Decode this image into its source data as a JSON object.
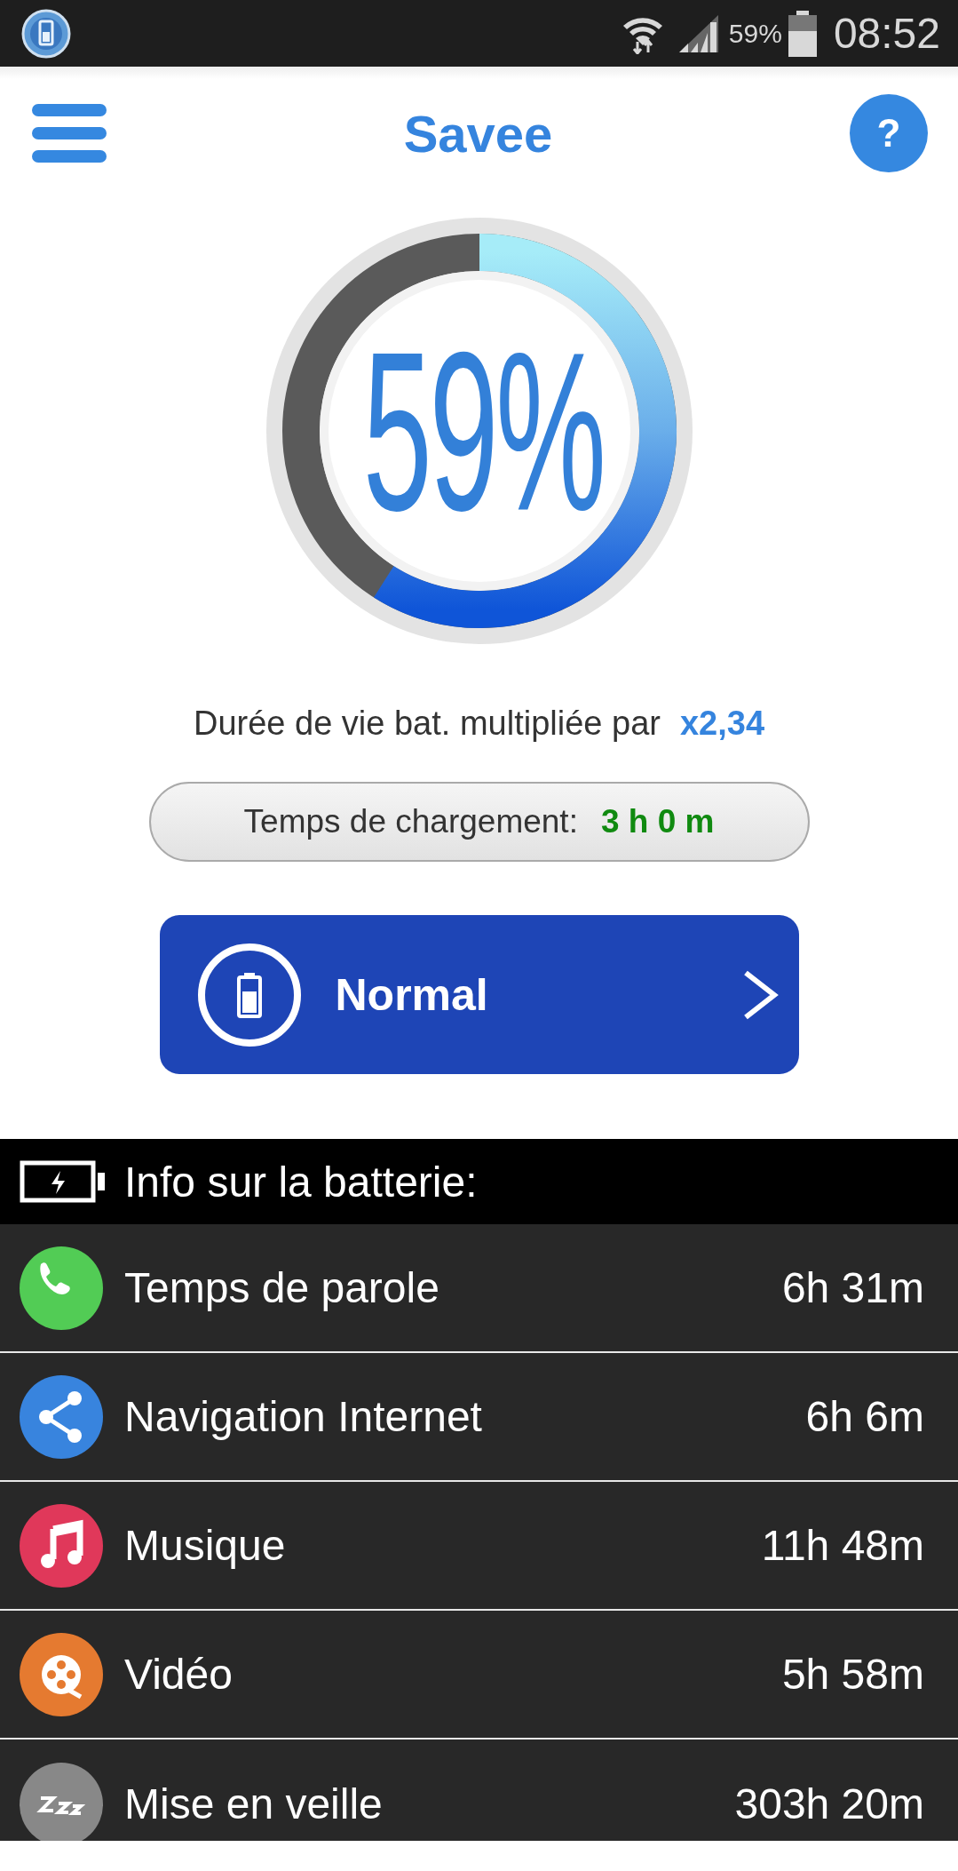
{
  "status_bar": {
    "battery_text": "59%",
    "time": "08:52"
  },
  "header": {
    "title": "Savee",
    "help": "?"
  },
  "gauge": {
    "reading": "59%"
  },
  "lifetime": {
    "label": "Durée de vie bat. multipliée par",
    "value": "x2,34"
  },
  "charge": {
    "label": "Temps de chargement:",
    "value": "3 h 0 m"
  },
  "mode_button": {
    "label": "Normal"
  },
  "info": {
    "title": "Info sur la batterie:",
    "rows": [
      {
        "kind": "phone",
        "color": "#52cc55",
        "label": "Temps de parole",
        "value": "6h 31m"
      },
      {
        "kind": "share",
        "color": "#3884de",
        "label": "Navigation Internet",
        "value": "6h 6m"
      },
      {
        "kind": "music",
        "color": "#e0385a",
        "label": "Musique",
        "value": "11h 48m"
      },
      {
        "kind": "video",
        "color": "#e57a30",
        "label": "Vidéo",
        "value": "5h 58m"
      },
      {
        "kind": "sleep",
        "color": "#888888",
        "label": "Mise en veille",
        "value": "303h 20m"
      }
    ]
  }
}
